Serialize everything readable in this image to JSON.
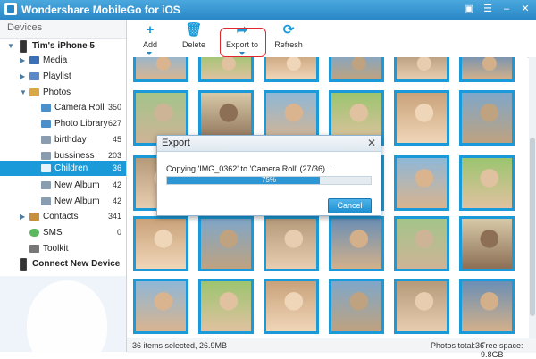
{
  "window": {
    "title": "Wondershare MobileGo for iOS",
    "controls": [
      "chat-icon",
      "menu-icon",
      "minimize-icon",
      "close-icon"
    ]
  },
  "sidebar": {
    "header": "Devices",
    "device": "Tim's iPhone 5",
    "items": [
      {
        "label": "Media",
        "count": ""
      },
      {
        "label": "Playlist",
        "count": ""
      },
      {
        "label": "Photos",
        "count": ""
      },
      {
        "label": "Camera Roll",
        "count": "350"
      },
      {
        "label": "Photo Library",
        "count": "627"
      },
      {
        "label": "birthday",
        "count": "45"
      },
      {
        "label": "bussiness",
        "count": "203"
      },
      {
        "label": "Children",
        "count": "36"
      },
      {
        "label": "New Album",
        "count": "42"
      },
      {
        "label": "New Album",
        "count": "42"
      },
      {
        "label": "Contacts",
        "count": "341"
      },
      {
        "label": "SMS",
        "count": "0"
      },
      {
        "label": "Toolkit",
        "count": ""
      }
    ],
    "connect": "Connect New Device"
  },
  "toolbar": {
    "add": "Add",
    "delete": "Delete",
    "export": "Export to",
    "refresh": "Refresh"
  },
  "dialog": {
    "title": "Export",
    "message": "Copying 'IMG_0362' to 'Camera Roll' (27/36)...",
    "progress_label": "75%",
    "progress_value": 0.75,
    "cancel": "Cancel"
  },
  "status": {
    "selected": "36 items selected, 26.9MB",
    "total": "Photos total:36",
    "free": "Free space: 9.8GB"
  },
  "colors": {
    "accent": "#1a9ad8",
    "highlight": "#e0262e"
  }
}
